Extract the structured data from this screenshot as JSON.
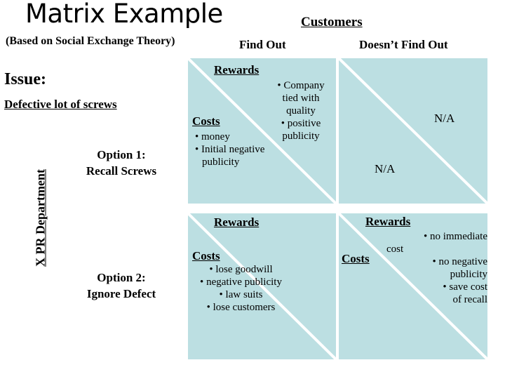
{
  "slide": {
    "title": "Matrix Example",
    "subtitle": "(Based on Social Exchange Theory)"
  },
  "colors": {
    "cell_fill": "#bcdfe2",
    "diagonal": "#ffffff",
    "text": "#000000",
    "background": "#ffffff"
  },
  "column_group": {
    "label": "Customers",
    "headers": [
      "Find Out",
      "Doesn’t Find Out"
    ]
  },
  "row_group": {
    "label": "X PR Department",
    "headers": [
      {
        "line1": "Option 1:",
        "line2": "Recall Screws"
      },
      {
        "line1": "Option 2:",
        "line2": "Ignore Defect"
      }
    ]
  },
  "issue": {
    "label": "Issue:",
    "value": "Defective lot of screws"
  },
  "labels": {
    "rewards": "Rewards",
    "costs": "Costs",
    "na": "N/A"
  },
  "matrix": {
    "r1c1": {
      "rewards": [
        "Company",
        "tied with",
        "quality",
        "• positive",
        "publicity"
      ],
      "costs": [
        "money",
        "Initial negative publicity"
      ]
    },
    "r1c2": {
      "rewards_na": "N/A",
      "costs_na": "N/A"
    },
    "r2c1": {
      "rewards": [],
      "costs": [
        "lose goodwill",
        "negative publicity",
        "law suits",
        "lose customers"
      ]
    },
    "r2c2": {
      "rewards": [
        "• no immediate",
        "cost",
        "• no negative",
        "publicity",
        "• save cost",
        "of recall"
      ],
      "costs": []
    }
  }
}
